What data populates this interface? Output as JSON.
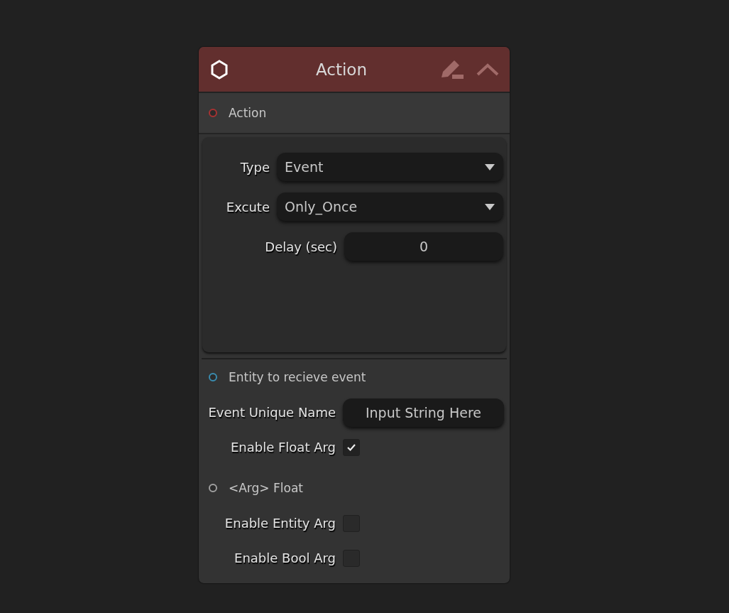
{
  "node": {
    "title": "Action"
  },
  "input_port": {
    "label": "Action",
    "color": "#a83232"
  },
  "settings": [
    {
      "kind": "dropdown",
      "label": "Type",
      "value": "Event"
    },
    {
      "kind": "dropdown",
      "label": "Excute",
      "value": "Only_Once"
    },
    {
      "kind": "number",
      "label": "Delay (sec)",
      "value": "0"
    }
  ],
  "sections": [
    {
      "port": {
        "label": "Entity to recieve event",
        "color": "#3a8db0"
      },
      "fields": [
        {
          "kind": "text",
          "label": "Event Unique Name",
          "placeholder": "Input String Here"
        },
        {
          "kind": "checkbox",
          "label": "Enable Float Arg",
          "checked": true
        }
      ]
    },
    {
      "port": {
        "label": "<Arg> Float",
        "color": "#a0a0a0"
      },
      "fields": [
        {
          "kind": "checkbox",
          "label": "Enable Entity Arg",
          "checked": false
        },
        {
          "kind": "checkbox",
          "label": "Enable Bool Arg",
          "checked": false
        }
      ]
    }
  ]
}
